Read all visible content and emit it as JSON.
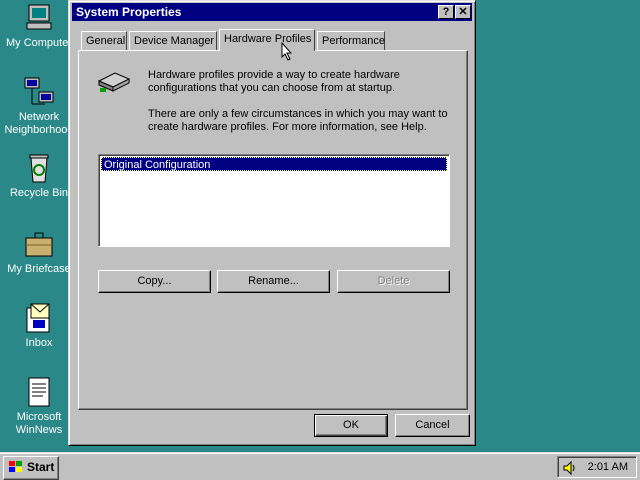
{
  "desktop": {
    "icons": [
      {
        "label": "My Computer"
      },
      {
        "label": "Network Neighborhood"
      },
      {
        "label": "Recycle Bin"
      },
      {
        "label": "My Briefcase"
      },
      {
        "label": "Inbox"
      },
      {
        "label": "Microsoft WinNews"
      }
    ],
    "background_color": "#2a8888"
  },
  "window": {
    "title": "System Properties",
    "help_button": "?",
    "close_button": "✕",
    "tabs": [
      {
        "label": "General",
        "active": false
      },
      {
        "label": "Device Manager",
        "active": false
      },
      {
        "label": "Hardware Profiles",
        "active": true
      },
      {
        "label": "Performance",
        "active": false
      }
    ],
    "info_text_1": "Hardware profiles provide a way to create hardware configurations that you can choose from at startup.",
    "info_text_2": "There are only a few circumstances in which you may want to create hardware profiles. For more information, see Help.",
    "profiles": [
      {
        "name": "Original Configuration",
        "selected": true
      }
    ],
    "buttons": {
      "copy": "Copy...",
      "rename": "Rename...",
      "delete": "Delete",
      "ok": "OK",
      "cancel": "Cancel"
    }
  },
  "taskbar": {
    "start_label": "Start",
    "clock": "2:01 AM"
  },
  "colors": {
    "titlebar": "#000080",
    "face": "#c0c0c0",
    "selection": "#000080"
  }
}
